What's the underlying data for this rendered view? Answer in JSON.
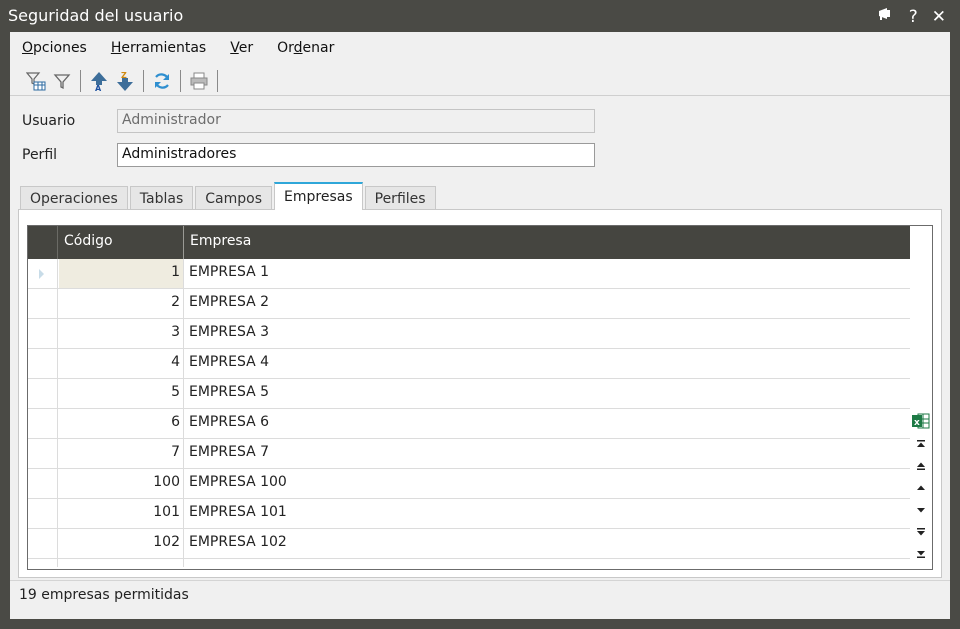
{
  "window": {
    "title": "Seguridad del usuario",
    "controls": {
      "help_label": "?",
      "close_label": "✕"
    }
  },
  "menu": [
    {
      "underline": "O",
      "rest": "pciones"
    },
    {
      "underline": "H",
      "rest": "erramientas"
    },
    {
      "underline": "V",
      "rest": "er"
    },
    {
      "pre": "Or",
      "underline": "d",
      "rest": "enar"
    }
  ],
  "toolbar": {
    "icons": [
      "filter-table-icon",
      "filter-icon",
      "sort-ascending-icon",
      "sort-descending-icon",
      "refresh-icon",
      "print-icon"
    ]
  },
  "form": {
    "usuario": {
      "label": "Usuario",
      "value": "Administrador"
    },
    "perfil": {
      "label": "Perfil",
      "value": "Administradores"
    }
  },
  "tabs": [
    {
      "label": "Operaciones",
      "active": false
    },
    {
      "label": "Tablas",
      "active": false
    },
    {
      "label": "Campos",
      "active": false
    },
    {
      "label": "Empresas",
      "active": true
    },
    {
      "label": "Perfiles",
      "active": false
    }
  ],
  "grid": {
    "columns": {
      "code": "Código",
      "empresa": "Empresa"
    },
    "rows": [
      {
        "code": "1",
        "empresa": "EMPRESA 1"
      },
      {
        "code": "2",
        "empresa": "EMPRESA 2"
      },
      {
        "code": "3",
        "empresa": "EMPRESA 3"
      },
      {
        "code": "4",
        "empresa": "EMPRESA 4"
      },
      {
        "code": "5",
        "empresa": "EMPRESA 5"
      },
      {
        "code": "6",
        "empresa": "EMPRESA 6"
      },
      {
        "code": "7",
        "empresa": "EMPRESA 7"
      },
      {
        "code": "100",
        "empresa": "EMPRESA 100"
      },
      {
        "code": "101",
        "empresa": "EMPRESA 101"
      },
      {
        "code": "102",
        "empresa": "EMPRESA 102"
      }
    ],
    "nav_icons": [
      "excel-export-icon",
      "first-record-icon",
      "previous-page-icon",
      "previous-record-icon",
      "next-record-icon",
      "next-page-icon",
      "last-record-icon"
    ]
  },
  "status": {
    "text": "19 empresas permitidas"
  },
  "colors": {
    "titlebar": "#4a4a45",
    "grid_header": "#454540",
    "active_tab_accent": "#2fa7d9",
    "current_row": "#efece0"
  }
}
